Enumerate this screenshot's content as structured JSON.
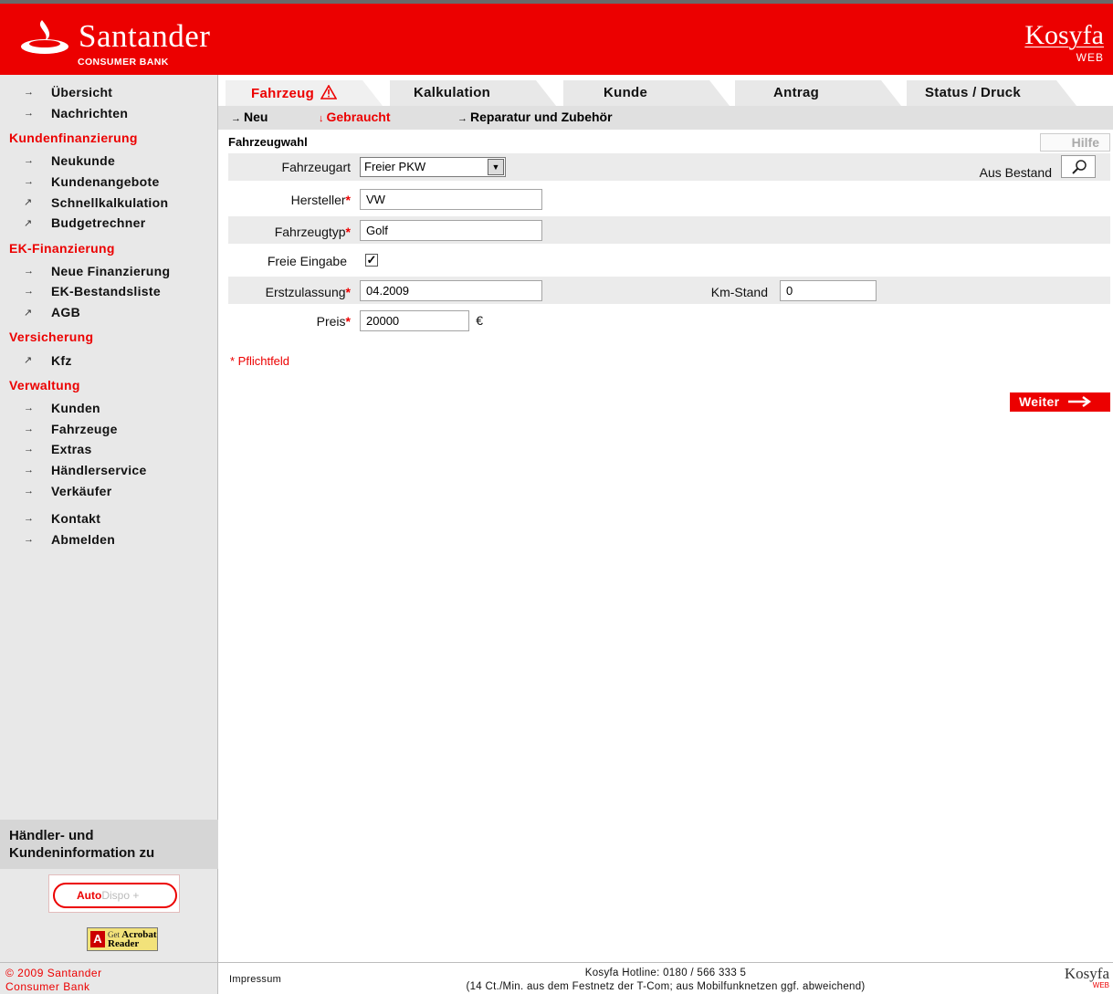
{
  "header": {
    "brand_name": "Santander",
    "brand_sub": "CONSUMER BANK",
    "product_name": "Kosyfa",
    "product_sub": "WEB"
  },
  "sidebar": {
    "top_items": [
      {
        "label": "Übersicht",
        "icon": "arrow-right-icon"
      },
      {
        "label": "Nachrichten",
        "icon": "arrow-right-icon"
      }
    ],
    "sections": [
      {
        "heading": "Kundenfinanzierung",
        "items": [
          {
            "label": "Neukunde",
            "icon": "arrow-right-icon"
          },
          {
            "label": "Kundenangebote",
            "icon": "arrow-right-icon"
          },
          {
            "label": "Schnellkalkulation",
            "icon": "external-arrow-icon"
          },
          {
            "label": "Budgetrechner",
            "icon": "external-arrow-icon"
          }
        ]
      },
      {
        "heading": "EK-Finanzierung",
        "items": [
          {
            "label": "Neue Finanzierung",
            "icon": "arrow-right-icon"
          },
          {
            "label": "EK-Bestandsliste",
            "icon": "arrow-right-icon"
          },
          {
            "label": "AGB",
            "icon": "external-arrow-icon"
          }
        ]
      },
      {
        "heading": "Versicherung",
        "items": [
          {
            "label": "Kfz",
            "icon": "external-arrow-icon"
          }
        ]
      },
      {
        "heading": "Verwaltung",
        "items": [
          {
            "label": "Kunden",
            "icon": "arrow-right-icon"
          },
          {
            "label": "Fahrzeuge",
            "icon": "arrow-right-icon"
          },
          {
            "label": "Extras",
            "icon": "arrow-right-icon"
          },
          {
            "label": "Händlerservice",
            "icon": "arrow-right-icon"
          },
          {
            "label": "Verkäufer",
            "icon": "arrow-right-icon"
          }
        ]
      }
    ],
    "bottom_items": [
      {
        "label": "Kontakt",
        "icon": "arrow-right-icon"
      },
      {
        "label": "Abmelden",
        "icon": "arrow-right-icon"
      }
    ],
    "info_title": "Händler- und Kundeninformation zu",
    "autodispo": {
      "part1": "Auto",
      "part2": "Dispo +"
    },
    "acrobat": {
      "get": "Get",
      "brand": "Acrobat",
      "reader": "Reader",
      "adobe": "Adobe"
    },
    "copyright_line1": "© 2009 Santander",
    "copyright_line2": "Consumer Bank"
  },
  "tabs": [
    {
      "label": "Fahrzeug",
      "active": true,
      "warning_icon": "warning-triangle-icon"
    },
    {
      "label": "Kalkulation",
      "active": false
    },
    {
      "label": "Kunde",
      "active": false
    },
    {
      "label": "Antrag",
      "active": false
    },
    {
      "label": "Status / Druck",
      "active": false
    }
  ],
  "subnav": [
    {
      "label": "Neu",
      "active": false,
      "icon": "arrow-right-icon"
    },
    {
      "label": "Gebraucht",
      "active": true,
      "icon": "arrow-down-icon"
    },
    {
      "label": "Reparatur und Zubehör",
      "active": false,
      "icon": "arrow-right-icon"
    }
  ],
  "form": {
    "title": "Fahrzeugwahl",
    "help_label": "Hilfe",
    "fahrzeugart": {
      "label": "Fahrzeugart",
      "value": "Freier PKW"
    },
    "aus_bestand_label": "Aus Bestand",
    "hersteller": {
      "label": "Hersteller",
      "value": "VW"
    },
    "fahrzeugtyp": {
      "label": "Fahrzeugtyp",
      "value": "Golf"
    },
    "freie_eingabe": {
      "label": "Freie Eingabe",
      "checked": true
    },
    "erstzulassung": {
      "label": "Erstzulassung",
      "value": "04.2009"
    },
    "km_stand": {
      "label": "Km-Stand",
      "value": "0"
    },
    "preis": {
      "label": "Preis",
      "value": "20000",
      "currency": "€"
    },
    "required_star": "*",
    "required_note": "* Pflichtfeld",
    "next_label": "Weiter"
  },
  "footer": {
    "impressum": "Impressum",
    "hotline_line1": "Kosyfa Hotline: 0180 / 566 333 5",
    "hotline_line2": "(14 Ct./Min. aus dem Festnetz der T-Com; aus Mobilfunknetzen ggf. abweichend)",
    "logo_name": "Kosyfa",
    "logo_sub": "WEB"
  },
  "colors": {
    "brand_red": "#ec0000",
    "sidebar_bg": "#e8e8e8",
    "row_bg": "#ebebeb"
  }
}
